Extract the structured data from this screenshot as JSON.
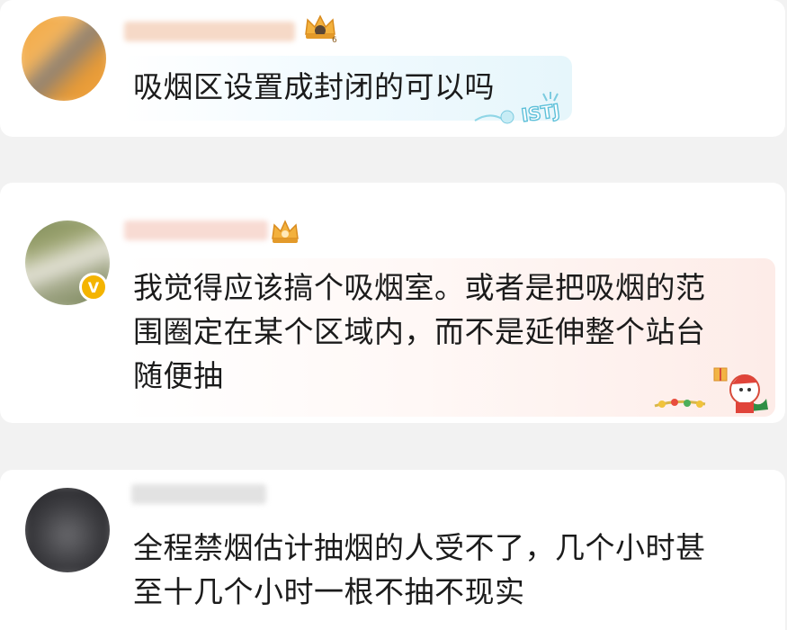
{
  "comments": [
    {
      "text_lines": [
        "吸烟区设置成封闭的可以吗"
      ],
      "badge_icon": "crown-icon",
      "decoration_icon": "istj-sticker-icon"
    },
    {
      "text_lines": [
        "我觉得应该搞个吸烟室。或者是把吸烟的范",
        "围圈定在某个区域内，而不是延伸整个站台",
        "随便抽"
      ],
      "badge_icon": "crown-icon",
      "verified_badge": "V",
      "decoration_icon": "christmas-santa-icon"
    },
    {
      "text_lines": [
        "全程禁烟估计抽烟的人受不了，几个小时甚",
        "至十几个小时一根不抽不现实"
      ]
    }
  ],
  "colors": {
    "page_bg": "#f2f2f2",
    "card_bg": "#ffffff",
    "text": "#1b1b1b",
    "badge_gold": "#f2a63a"
  }
}
